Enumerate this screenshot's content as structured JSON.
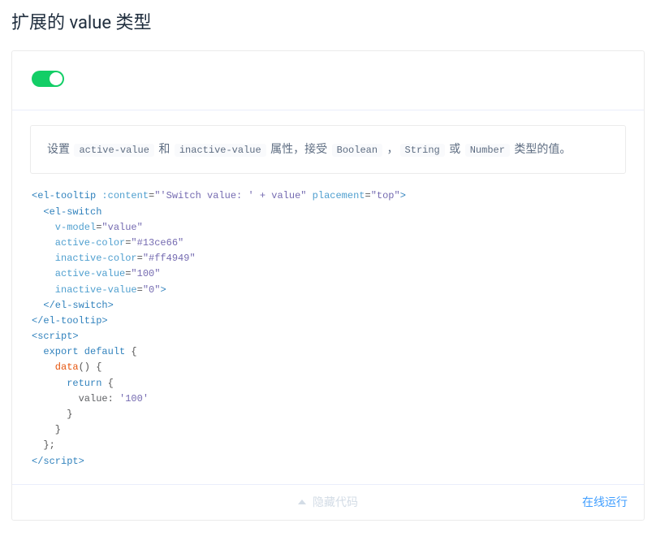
{
  "title": "扩展的 value 类型",
  "switch": {
    "on": true,
    "active_color": "#13ce66",
    "inactive_color": "#ff4949"
  },
  "description": {
    "p1": "设置 ",
    "c1": "active-value",
    "p2": " 和 ",
    "c2": "inactive-value",
    "p3": " 属性，接受 ",
    "c3": "Boolean",
    "p4": " ，",
    "c4": "String",
    "p5": " 或 ",
    "c5": "Number",
    "p6": " 类型的值。"
  },
  "code": {
    "l01a": "<el-tooltip",
    "l01b": ":content",
    "l01c": "=",
    "l01d": "\"'Switch value: ' + value\"",
    "l01e": "placement",
    "l01f": "=",
    "l01g": "\"top\"",
    "l01h": ">",
    "l02": "  <el-switch",
    "l03a": "    v-model",
    "l03b": "=",
    "l03c": "\"value\"",
    "l04a": "    active-color",
    "l04b": "=",
    "l04c": "\"#13ce66\"",
    "l05a": "    inactive-color",
    "l05b": "=",
    "l05c": "\"#ff4949\"",
    "l06a": "    active-value",
    "l06b": "=",
    "l06c": "\"100\"",
    "l07a": "    inactive-value",
    "l07b": "=",
    "l07c": "\"0\"",
    "l07d": ">",
    "l08": "  </el-switch>",
    "l09": "</el-tooltip>",
    "blank": "",
    "l10": "<script>",
    "l11a": "  export",
    "l11b": " default",
    "l11c": " {",
    "l12a": "    data",
    "l12b": "()",
    "l12c": " {",
    "l13a": "      return",
    "l13b": " {",
    "l14a": "        value",
    "l14b": ": ",
    "l14c": "'100'",
    "l15": "      }",
    "l16": "    }",
    "l17": "  };",
    "l18": "</scr",
    "l18b": "ipt>"
  },
  "controls": {
    "hide_code": "隐藏代码",
    "run_online": "在线运行"
  }
}
